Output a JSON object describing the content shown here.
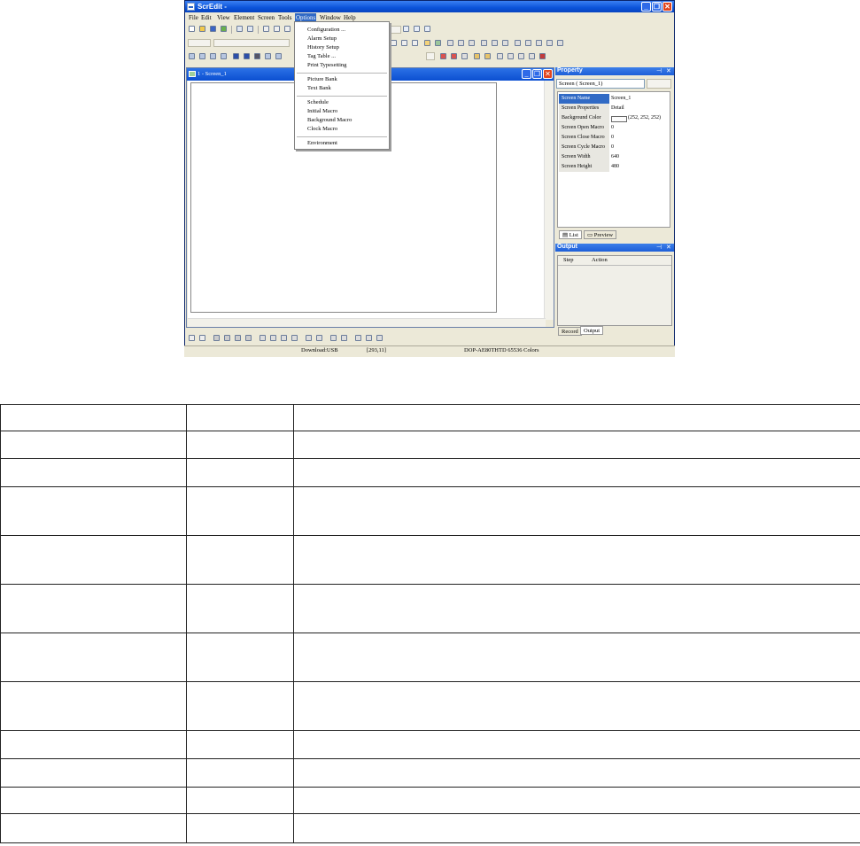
{
  "window": {
    "title": "ScrEdit -",
    "min_glyph": "_",
    "max_glyph": "❐",
    "close_glyph": "✕"
  },
  "menubar": [
    "File",
    "Edit",
    "View",
    "Element",
    "Screen",
    "Tools",
    "Options",
    "Window",
    "Help"
  ],
  "options_menu": {
    "group1": [
      "Configuration ...",
      "Alarm Setup",
      "History Setup",
      "Tag Table ...",
      "Print Typesetting"
    ],
    "group2": [
      "Picture Bank",
      "Text Bank"
    ],
    "group3": [
      "Schedule",
      "Initial Macro",
      "Background Macro",
      "Clock Macro"
    ],
    "group4": [
      "Environment"
    ]
  },
  "child_window": {
    "title": "1 - Screen_1"
  },
  "property_panel": {
    "title": "Property",
    "selector": "Screen ( Screen_1)",
    "rows": [
      {
        "key": "Screen Name",
        "value": "Screen_1"
      },
      {
        "key": "Screen Properties",
        "value": "Detail"
      },
      {
        "key": "Background Color",
        "value": "(252, 252, 252)"
      },
      {
        "key": "Screen Open Macro",
        "value": "0"
      },
      {
        "key": "Screen Close Macro",
        "value": "0"
      },
      {
        "key": "Screen Cycle Macro",
        "value": "0"
      },
      {
        "key": "Screen Width",
        "value": "640"
      },
      {
        "key": "Screen Height",
        "value": "480"
      }
    ],
    "tabs": [
      "List",
      "Preview"
    ]
  },
  "output_panel": {
    "title": "Output",
    "columns": [
      "Step",
      "Action"
    ],
    "tabs": [
      "Record",
      "Output"
    ]
  },
  "panel_buttons": {
    "pin": "⊣",
    "close": "✕"
  },
  "statusbar": {
    "download": "Download:USB",
    "coords": "[293,11]",
    "device": "DOP-AE80THTD 65536 Colors"
  },
  "colors": {
    "titlebar": "#0b53d9",
    "menu_highlight": "#316ac5",
    "face": "#ece9d8",
    "close": "#e0461f"
  }
}
